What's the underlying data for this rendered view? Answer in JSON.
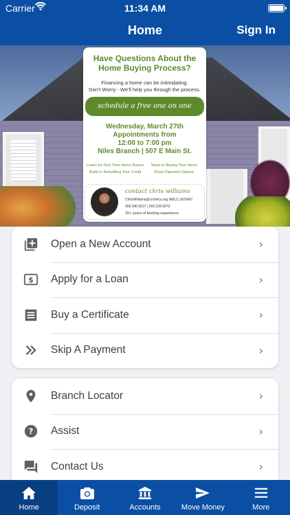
{
  "status_bar": {
    "carrier": "Carrier",
    "time": "11:34 AM"
  },
  "nav": {
    "title": "Home",
    "sign_in": "Sign In"
  },
  "flyer": {
    "headline": "Have Questions About the Home Buying Process?",
    "subtext_1": "Financing a home can be intimidating.",
    "subtext_2": "Don't Worry - We'll help you through the process.",
    "cta": "schedule a free one on one appointment",
    "date_line": "Wednesday, March 27th",
    "appointments_line": "Appointments from",
    "time_line": "12:00 to 7:00 pm",
    "branch_line": "Niles Branch | 507 E Main St.",
    "links": [
      "Loans for First Time Home Buyers",
      "Steps to Buying Your Home",
      "Build or Rebuilding Your Credit",
      "Down Payment Options"
    ],
    "contact_title": "contact chris williams",
    "contact_email": "ChrisWilliams@circlefcu.org   NMLS 1623457",
    "contact_phone": "269.340.5637 | 269.228.0073",
    "contact_experience": "20+ years of lending experience"
  },
  "menu_primary": [
    {
      "label": "Open a New Account",
      "icon": "add-box-icon"
    },
    {
      "label": "Apply for a Loan",
      "icon": "dollar-icon"
    },
    {
      "label": "Buy a Certificate",
      "icon": "certificate-icon"
    },
    {
      "label": "Skip A Payment",
      "icon": "double-chevron-icon"
    }
  ],
  "menu_secondary": [
    {
      "label": "Branch Locator",
      "icon": "location-pin-icon"
    },
    {
      "label": "Assist",
      "icon": "help-icon"
    },
    {
      "label": "Contact Us",
      "icon": "chat-icon"
    }
  ],
  "tabs": [
    {
      "label": "Home",
      "icon": "home-icon"
    },
    {
      "label": "Deposit",
      "icon": "camera-icon"
    },
    {
      "label": "Accounts",
      "icon": "bank-icon"
    },
    {
      "label": "Move Money",
      "icon": "send-icon"
    },
    {
      "label": "More",
      "icon": "menu-icon"
    }
  ],
  "colors": {
    "brand_blue": "#0a4fa3",
    "flyer_green": "#5f8a2c",
    "background": "#eef0f3"
  }
}
